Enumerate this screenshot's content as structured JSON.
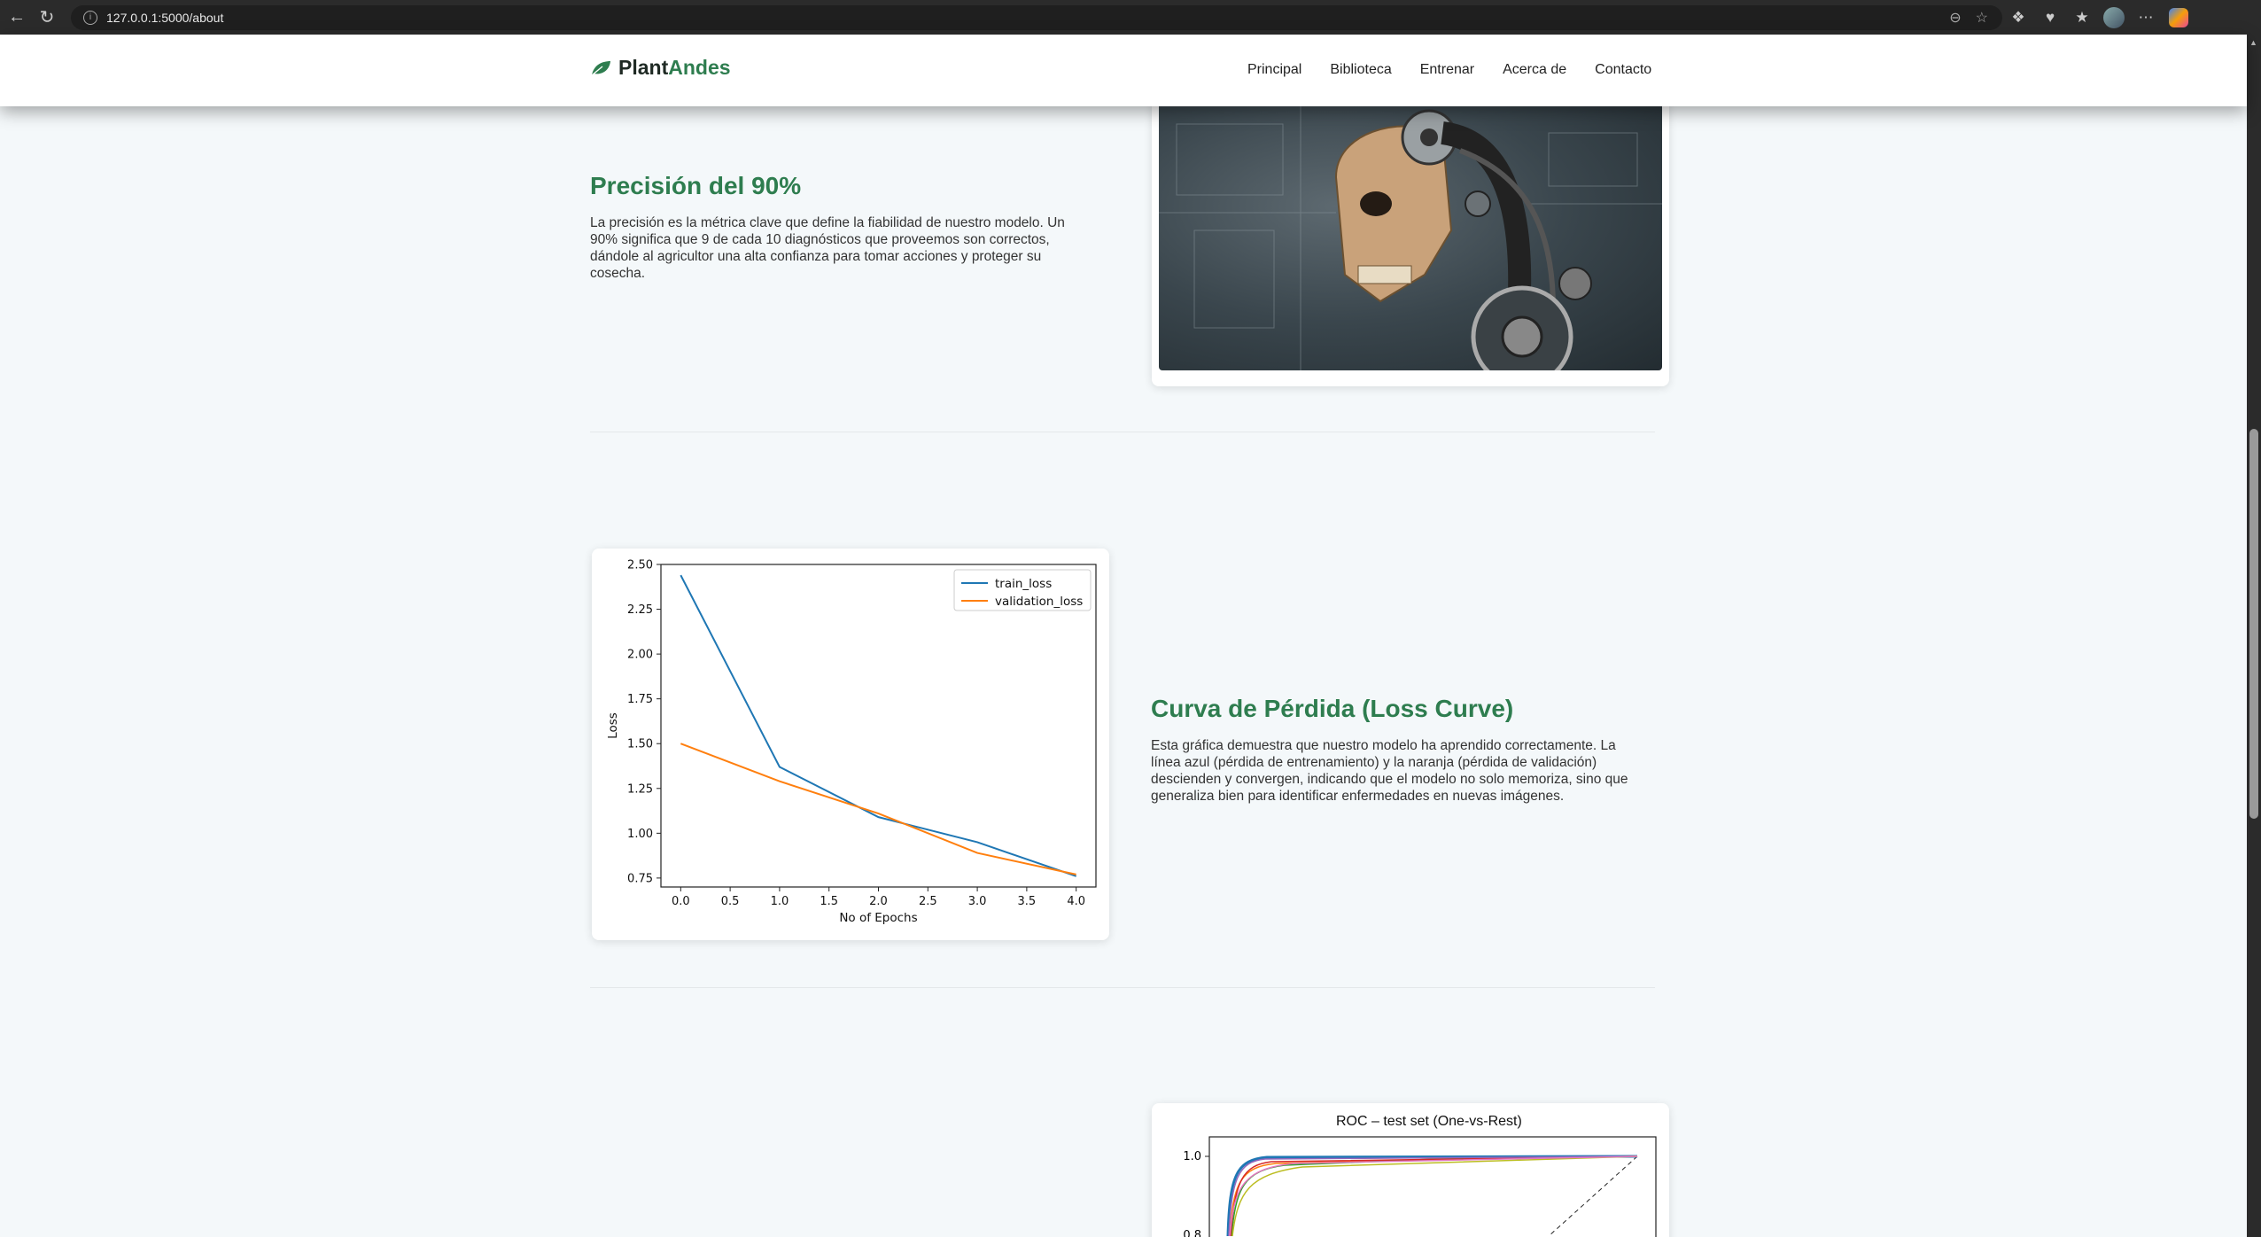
{
  "browser": {
    "url": "127.0.0.1:5000/about"
  },
  "navbar": {
    "brand_plant": "Plant",
    "brand_andes": "Andes",
    "links": [
      "Principal",
      "Biblioteca",
      "Entrenar",
      "Acerca de",
      "Contacto"
    ]
  },
  "accuracy_section": {
    "title": "Precisión del 90%",
    "text": "La precisión es la métrica clave que define la fiabilidad de nuestro modelo. Un 90% significa que 9 de cada 10 diagnósticos que proveemos son correctos, dándole al agricultor una alta confianza para tomar acciones y proteger su cosecha."
  },
  "loss_section": {
    "title": "Curva de Pérdida (Loss Curve)",
    "text": "Esta gráfica demuestra que nuestro modelo ha aprendido correctamente. La línea azul (pérdida de entrenamiento) y la naranja (pérdida de validación) descienden y convergen, indicando que el modelo no solo memoriza, sino que generaliza bien para identificar enfermedades en nuevas imágenes."
  },
  "roc_section": {
    "title": "ROC – test set (One-vs-Rest)",
    "yticks": [
      "1.0",
      "0.8"
    ]
  },
  "chart_data": [
    {
      "type": "line",
      "x": [
        0,
        1,
        2,
        3,
        4
      ],
      "xlabel": "No of Epochs",
      "ylabel": "Loss",
      "xlim": [
        -0.2,
        4.2
      ],
      "ylim": [
        0.7,
        2.5
      ],
      "xticks": [
        "0.0",
        "0.5",
        "1.0",
        "1.5",
        "2.0",
        "2.5",
        "3.0",
        "3.5",
        "4.0"
      ],
      "yticks": [
        "0.75",
        "1.00",
        "1.25",
        "1.50",
        "1.75",
        "2.00",
        "2.25",
        "2.50"
      ],
      "legend": "top-right",
      "series": [
        {
          "name": "train_loss",
          "color": "#1f77b4",
          "values": [
            2.44,
            1.37,
            1.09,
            0.95,
            0.76
          ]
        },
        {
          "name": "validation_loss",
          "color": "#ff7f0e",
          "values": [
            1.5,
            1.29,
            1.11,
            0.89,
            0.77
          ]
        }
      ]
    }
  ]
}
